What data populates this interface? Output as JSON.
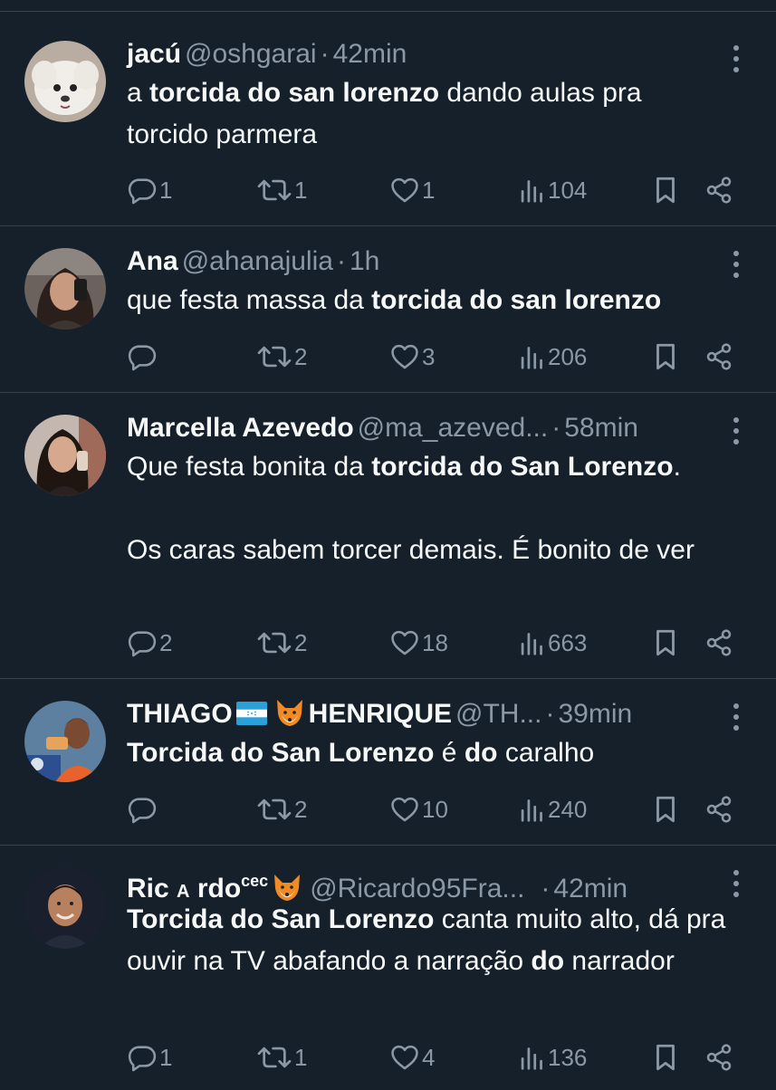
{
  "colors": {
    "background": "#15202b",
    "divider": "#38444d",
    "text": "#f7f9f9",
    "muted": "#8b98a5"
  },
  "tweets": [
    {
      "name": "jacú",
      "handle": "@oshgarai",
      "time": "42min",
      "segments": [
        {
          "t": "a ",
          "b": false
        },
        {
          "t": "torcida do san lorenzo",
          "b": true
        },
        {
          "t": " dando aulas pra torcido parmera",
          "b": false
        }
      ],
      "stats": {
        "replies": "1",
        "retweets": "1",
        "likes": "1",
        "views": "104"
      },
      "avatar": "white-dog-photo"
    },
    {
      "name": "Ana",
      "handle": "@ahanajulia",
      "time": "1h",
      "segments": [
        {
          "t": "que festa massa da ",
          "b": false
        },
        {
          "t": "torcida do san lorenzo",
          "b": true
        }
      ],
      "stats": {
        "replies": "",
        "retweets": "2",
        "likes": "3",
        "views": "206"
      },
      "avatar": "woman-selfie-photo"
    },
    {
      "name": "Marcella Azevedo",
      "handle": "@ma_azeved...",
      "time": "58min",
      "segments": [
        {
          "t": "Que festa bonita da ",
          "b": false
        },
        {
          "t": "torcida do San Lorenzo",
          "b": true
        },
        {
          "t": ".\n\nOs caras sabem torcer demais. É bonito de ver",
          "b": false
        }
      ],
      "stats": {
        "replies": "2",
        "retweets": "2",
        "likes": "18",
        "views": "663"
      },
      "avatar": "woman-selfie-photo"
    },
    {
      "name_parts": [
        "THIAGO",
        "HENRIQUE"
      ],
      "name_emojis": [
        "honduras-flag-emoji",
        "fox-emoji"
      ],
      "handle": "@TH...",
      "time": "39min",
      "segments": [
        {
          "t": "Torcida do San Lorenzo",
          "b": true
        },
        {
          "t": " é ",
          "b": false
        },
        {
          "t": "do",
          "b": true
        },
        {
          "t": " caralho",
          "b": false
        }
      ],
      "stats": {
        "replies": "",
        "retweets": "2",
        "likes": "10",
        "views": "240"
      },
      "avatar": "man-orange-jersey-photo"
    },
    {
      "name_parts": [
        "Ric",
        "A",
        "rdo",
        "cec"
      ],
      "name_emojis": [
        "fox-emoji"
      ],
      "handle": "@Ricardo95Fra...",
      "time": "42min",
      "segments": [
        {
          "t": "Torcida do San Lorenzo",
          "b": true
        },
        {
          "t": " canta muito alto, dá pra ouvir na TV abafando a narração ",
          "b": false
        },
        {
          "t": "do",
          "b": true
        },
        {
          "t": " narrador",
          "b": false
        }
      ],
      "stats": {
        "replies": "1",
        "retweets": "1",
        "likes": "4",
        "views": "136"
      },
      "avatar": "man-portrait-photo"
    }
  ]
}
